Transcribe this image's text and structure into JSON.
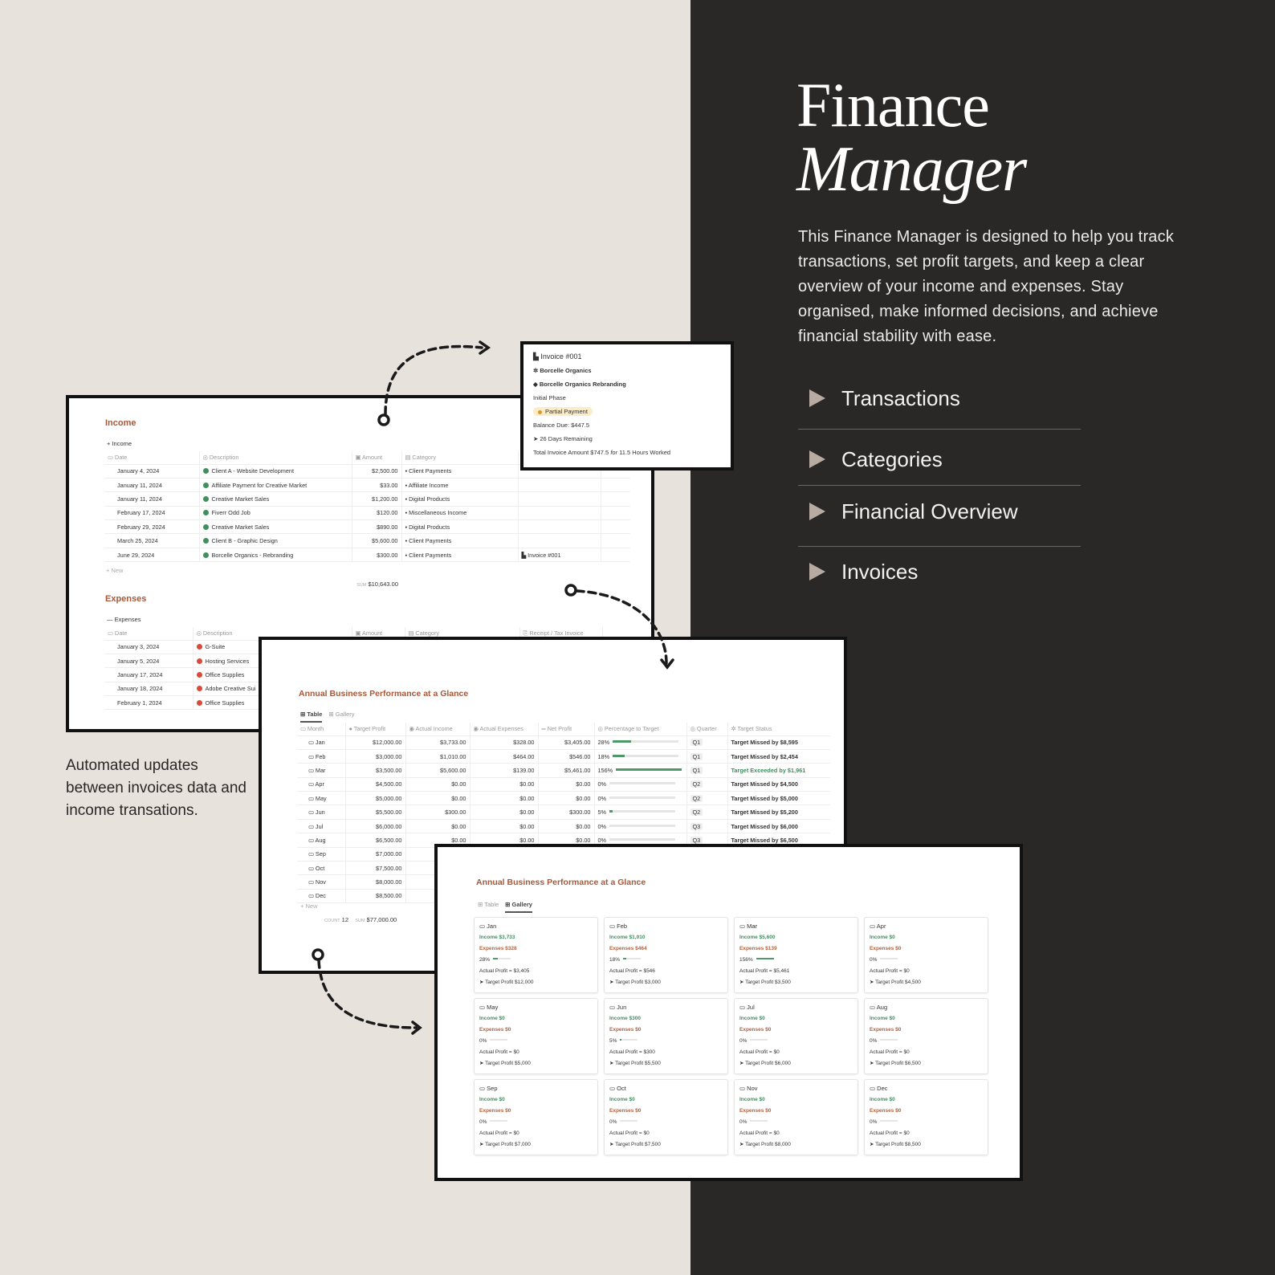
{
  "colors": {
    "left_bg": "#e7e2dc",
    "right_bg": "#2a2727",
    "accent": "#a5583a",
    "income_green": "#3f8f5f",
    "expense_red": "#d84a3a"
  },
  "hero": {
    "title_line1": "Finance",
    "title_line2": "Manager",
    "description": "This Finance Manager is designed to help you track transactions, set profit targets, and keep a clear overview of your income and expenses. Stay organised, make informed decisions, and achieve financial stability with ease."
  },
  "nav": [
    {
      "label": "Transactions"
    },
    {
      "label": "Categories"
    },
    {
      "label": "Financial Overview"
    },
    {
      "label": "Invoices"
    }
  ],
  "caption": "Automated updates between invoices data and income transations.",
  "income": {
    "title": "Income",
    "group": "Income",
    "headers": [
      "Date",
      "Description",
      "Amount",
      "Category",
      ""
    ],
    "rows": [
      [
        "January 4, 2024",
        "Client A - Website Development",
        "$2,500.00",
        "Client Payments",
        ""
      ],
      [
        "January 11, 2024",
        "Affiliate Payment for Creative Market",
        "$33.00",
        "Affiliate Income",
        ""
      ],
      [
        "January 11, 2024",
        "Creative Market Sales",
        "$1,200.00",
        "Digital Products",
        ""
      ],
      [
        "February 17, 2024",
        "Fiverr Odd Job",
        "$120.00",
        "Miscellaneous Income",
        ""
      ],
      [
        "February 29, 2024",
        "Creative Market Sales",
        "$890.00",
        "Digital Products",
        ""
      ],
      [
        "March 25, 2024",
        "Client B - Graphic Design",
        "$5,600.00",
        "Client Payments",
        ""
      ],
      [
        "June 29, 2024",
        "Borcelle Organics - Rebranding",
        "$300.00",
        "Client Payments",
        "Invoice #001"
      ]
    ],
    "new_label": "New",
    "sum_label": "SUM",
    "sum": "$10,643.00"
  },
  "expenses": {
    "title": "Expenses",
    "group": "Expenses",
    "headers": [
      "Date",
      "Description",
      "Amount",
      "Category",
      "Receipt / Tax Invoice"
    ],
    "rows": [
      [
        "January 3, 2024",
        "G-Suite"
      ],
      [
        "January 5, 2024",
        "Hosting Services"
      ],
      [
        "January 17, 2024",
        "Office Supplies"
      ],
      [
        "January 18, 2024",
        "Adobe Creative Sui"
      ],
      [
        "February 1, 2024",
        "Office Supplies"
      ]
    ]
  },
  "invoice": {
    "title": "Invoice #001",
    "client": "Borcelle Organics",
    "project": "Borcelle Organics Rebranding",
    "phase": "Initial Phase",
    "status": "Partial Payment",
    "balance": "Balance Due: $447.5",
    "days": "26 Days Remaining",
    "total_a": "Total Invoice Amount $747.5",
    "total_for": "for",
    "total_b": "11.5 Hours Worked"
  },
  "performance": {
    "title": "Annual Business Performance at a Glance",
    "tabs": [
      "Table",
      "Gallery"
    ],
    "headers": [
      "Month",
      "Target Profit",
      "Actual Income",
      "Actual Expenses",
      "Net Profit",
      "Percentage to Target",
      "Quarter",
      "Target Status"
    ],
    "rows": [
      {
        "month": "Jan",
        "target": "$12,000.00",
        "income": "$3,733.00",
        "expenses": "$328.00",
        "net": "$3,405.00",
        "pct": "28%",
        "pct_value": 28,
        "quarter": "Q1",
        "status": "Target Missed by $8,595",
        "ok": false
      },
      {
        "month": "Feb",
        "target": "$3,000.00",
        "income": "$1,010.00",
        "expenses": "$464.00",
        "net": "$546.00",
        "pct": "18%",
        "pct_value": 18,
        "quarter": "Q1",
        "status": "Target Missed by $2,454",
        "ok": false
      },
      {
        "month": "Mar",
        "target": "$3,500.00",
        "income": "$5,600.00",
        "expenses": "$139.00",
        "net": "$5,461.00",
        "pct": "156%",
        "pct_value": 156,
        "quarter": "Q1",
        "status": "Target Exceeded by $1,961",
        "ok": true
      },
      {
        "month": "Apr",
        "target": "$4,500.00",
        "income": "$0.00",
        "expenses": "$0.00",
        "net": "$0.00",
        "pct": "0%",
        "pct_value": 0,
        "quarter": "Q2",
        "status": "Target Missed by $4,500",
        "ok": false
      },
      {
        "month": "May",
        "target": "$5,000.00",
        "income": "$0.00",
        "expenses": "$0.00",
        "net": "$0.00",
        "pct": "0%",
        "pct_value": 0,
        "quarter": "Q2",
        "status": "Target Missed by $5,000",
        "ok": false
      },
      {
        "month": "Jun",
        "target": "$5,500.00",
        "income": "$300.00",
        "expenses": "$0.00",
        "net": "$300.00",
        "pct": "5%",
        "pct_value": 5,
        "quarter": "Q2",
        "status": "Target Missed by $5,200",
        "ok": false
      },
      {
        "month": "Jul",
        "target": "$6,000.00",
        "income": "$0.00",
        "expenses": "$0.00",
        "net": "$0.00",
        "pct": "0%",
        "pct_value": 0,
        "quarter": "Q3",
        "status": "Target Missed by $6,000",
        "ok": false
      },
      {
        "month": "Aug",
        "target": "$6,500.00",
        "income": "$0.00",
        "expenses": "$0.00",
        "net": "$0.00",
        "pct": "0%",
        "pct_value": 0,
        "quarter": "Q3",
        "status": "Target Missed by $6,500",
        "ok": false
      },
      {
        "month": "Sep",
        "target": "$7,000.00"
      },
      {
        "month": "Oct",
        "target": "$7,500.00"
      },
      {
        "month": "Nov",
        "target": "$8,000.00"
      },
      {
        "month": "Dec",
        "target": "$8,500.00"
      }
    ],
    "new_label": "New",
    "count_label": "COUNT",
    "count": "12",
    "sum_label": "SUM",
    "sum": "$77,000.00"
  },
  "gallery": {
    "title": "Annual Business Performance at a Glance",
    "tabs": [
      "Table",
      "Gallery"
    ],
    "cards": [
      {
        "month": "Jan",
        "income": "Income $3,733",
        "expenses": "Expenses $328",
        "pct": "28%",
        "pct_value": 28,
        "profit": "Actual Profit = $3,405",
        "target": "Target Profit $12,000"
      },
      {
        "month": "Feb",
        "income": "Income $1,010",
        "expenses": "Expenses $464",
        "pct": "18%",
        "pct_value": 18,
        "profit": "Actual Profit = $546",
        "target": "Target Profit $3,000"
      },
      {
        "month": "Mar",
        "income": "Income $5,600",
        "expenses": "Expenses $139",
        "pct": "156%",
        "pct_value": 156,
        "profit": "Actual Profit = $5,461",
        "target": "Target Profit $3,500"
      },
      {
        "month": "Apr",
        "income": "Income $0",
        "expenses": "Expenses $0",
        "pct": "0%",
        "pct_value": 0,
        "profit": "Actual Profit = $0",
        "target": "Target Profit $4,500"
      },
      {
        "month": "May",
        "income": "Income $0",
        "expenses": "Expenses $0",
        "pct": "0%",
        "pct_value": 0,
        "profit": "Actual Profit = $0",
        "target": "Target Profit $5,000"
      },
      {
        "month": "Jun",
        "income": "Income $300",
        "expenses": "Expenses $0",
        "pct": "5%",
        "pct_value": 5,
        "profit": "Actual Profit = $300",
        "target": "Target Profit $5,500"
      },
      {
        "month": "Jul",
        "income": "Income $0",
        "expenses": "Expenses $0",
        "pct": "0%",
        "pct_value": 0,
        "profit": "Actual Profit = $0",
        "target": "Target Profit $6,000"
      },
      {
        "month": "Aug",
        "income": "Income $0",
        "expenses": "Expenses $0",
        "pct": "0%",
        "pct_value": 0,
        "profit": "Actual Profit = $0",
        "target": "Target Profit $6,500"
      },
      {
        "month": "Sep",
        "income": "Income $0",
        "expenses": "Expenses $0",
        "pct": "0%",
        "pct_value": 0,
        "profit": "Actual Profit = $0",
        "target": "Target Profit $7,000"
      },
      {
        "month": "Oct",
        "income": "Income $0",
        "expenses": "Expenses $0",
        "pct": "0%",
        "pct_value": 0,
        "profit": "Actual Profit = $0",
        "target": "Target Profit $7,500"
      },
      {
        "month": "Nov",
        "income": "Income $0",
        "expenses": "Expenses $0",
        "pct": "0%",
        "pct_value": 0,
        "profit": "Actual Profit = $0",
        "target": "Target Profit $8,000"
      },
      {
        "month": "Dec",
        "income": "Income $0",
        "expenses": "Expenses $0",
        "pct": "0%",
        "pct_value": 0,
        "profit": "Actual Profit = $0",
        "target": "Target Profit $8,500"
      }
    ]
  }
}
